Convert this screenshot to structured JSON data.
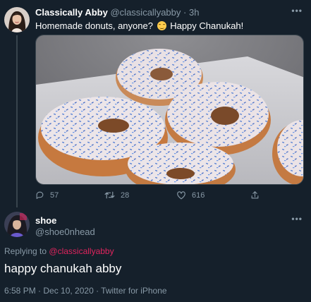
{
  "colors": {
    "background": "#15202b",
    "secondary_text": "#8899a6",
    "mention": "#e0245e",
    "divider": "#38444d"
  },
  "tweet": {
    "author_name": "Classically Abby",
    "handle": "@classicallyabby",
    "separator": "·",
    "time": "3h",
    "text_before_emoji": "Homemade donuts, anyone?",
    "emoji": "smiling-face-emoji",
    "text_after_emoji": "Happy Chanukah!",
    "media_description": "donuts-photo",
    "actions": {
      "replies": "57",
      "retweets": "28",
      "likes": "616"
    },
    "more_icon": "ellipsis-icon"
  },
  "reply": {
    "author_name": "shoe",
    "handle": "@shoe0nhead",
    "replying_prefix": "Replying to",
    "replying_mention": "@classicallyabby",
    "text": "happy chanukah abby",
    "meta": "6:58 PM · Dec 10, 2020 · Twitter for iPhone",
    "more_icon": "ellipsis-icon"
  }
}
